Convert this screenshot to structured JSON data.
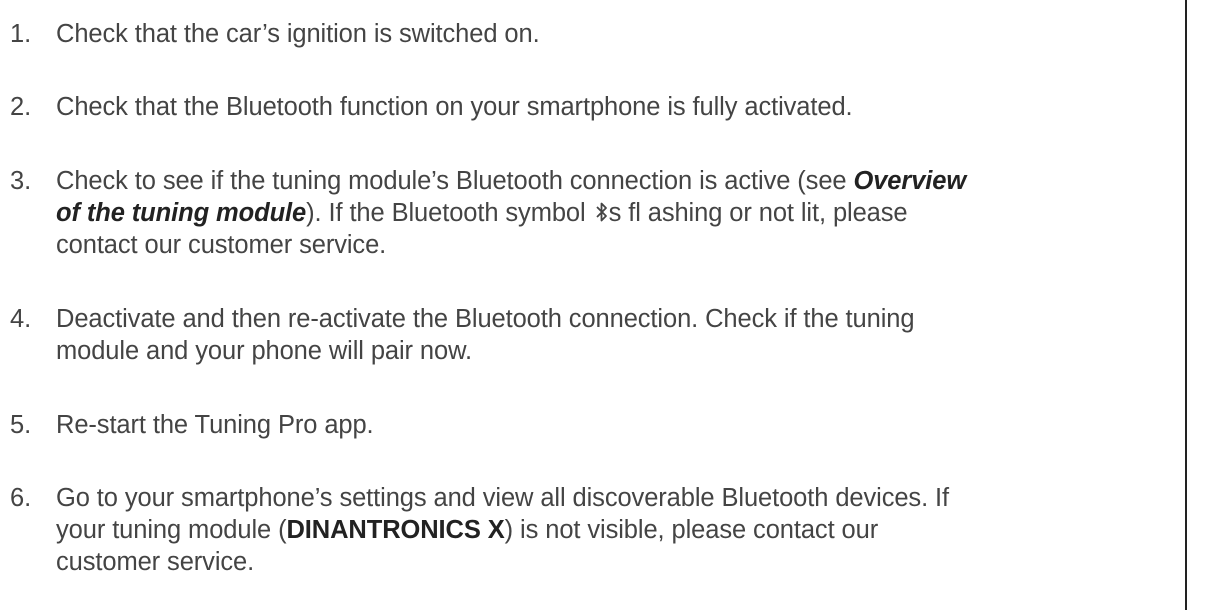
{
  "steps": [
    {
      "number": "1.",
      "lines": [
        [
          "Check that the car’s ignition is switched on."
        ]
      ]
    },
    {
      "number": "2.",
      "lines": [
        [
          "Check that the Bluetooth function on your smartphone is fully activated."
        ]
      ]
    },
    {
      "number": "3.",
      "line1_a": "Check to see if the tuning module’s Bluetooth connection is active (see ",
      "line1_b": "Overview",
      "line2_a": "of the tuning module",
      "line2_b": "). If the Bluetooth symbol ",
      "line2_c": "s fl ashing or not lit, please",
      "line3": "contact our customer service."
    },
    {
      "number": "4.",
      "line1": "Deactivate and then re-activate the Bluetooth connection. Check if the tuning",
      "line2": "module and your phone will pair now."
    },
    {
      "number": "5.",
      "line1": "Re-start the Tuning Pro app."
    },
    {
      "number": "6.",
      "line1": "Go to your smartphone’s settings and view all discoverable Bluetooth devices. If",
      "line2_a": "your tuning module (",
      "line2_b": "DINANTRONICS X",
      "line2_c": ") is not visible, please contact our",
      "line3": "customer service."
    }
  ],
  "icons": {
    "bluetooth": "bluetooth-icon"
  },
  "colors": {
    "text": "#444444",
    "emphasis": "#222222",
    "rule": "#222222"
  }
}
